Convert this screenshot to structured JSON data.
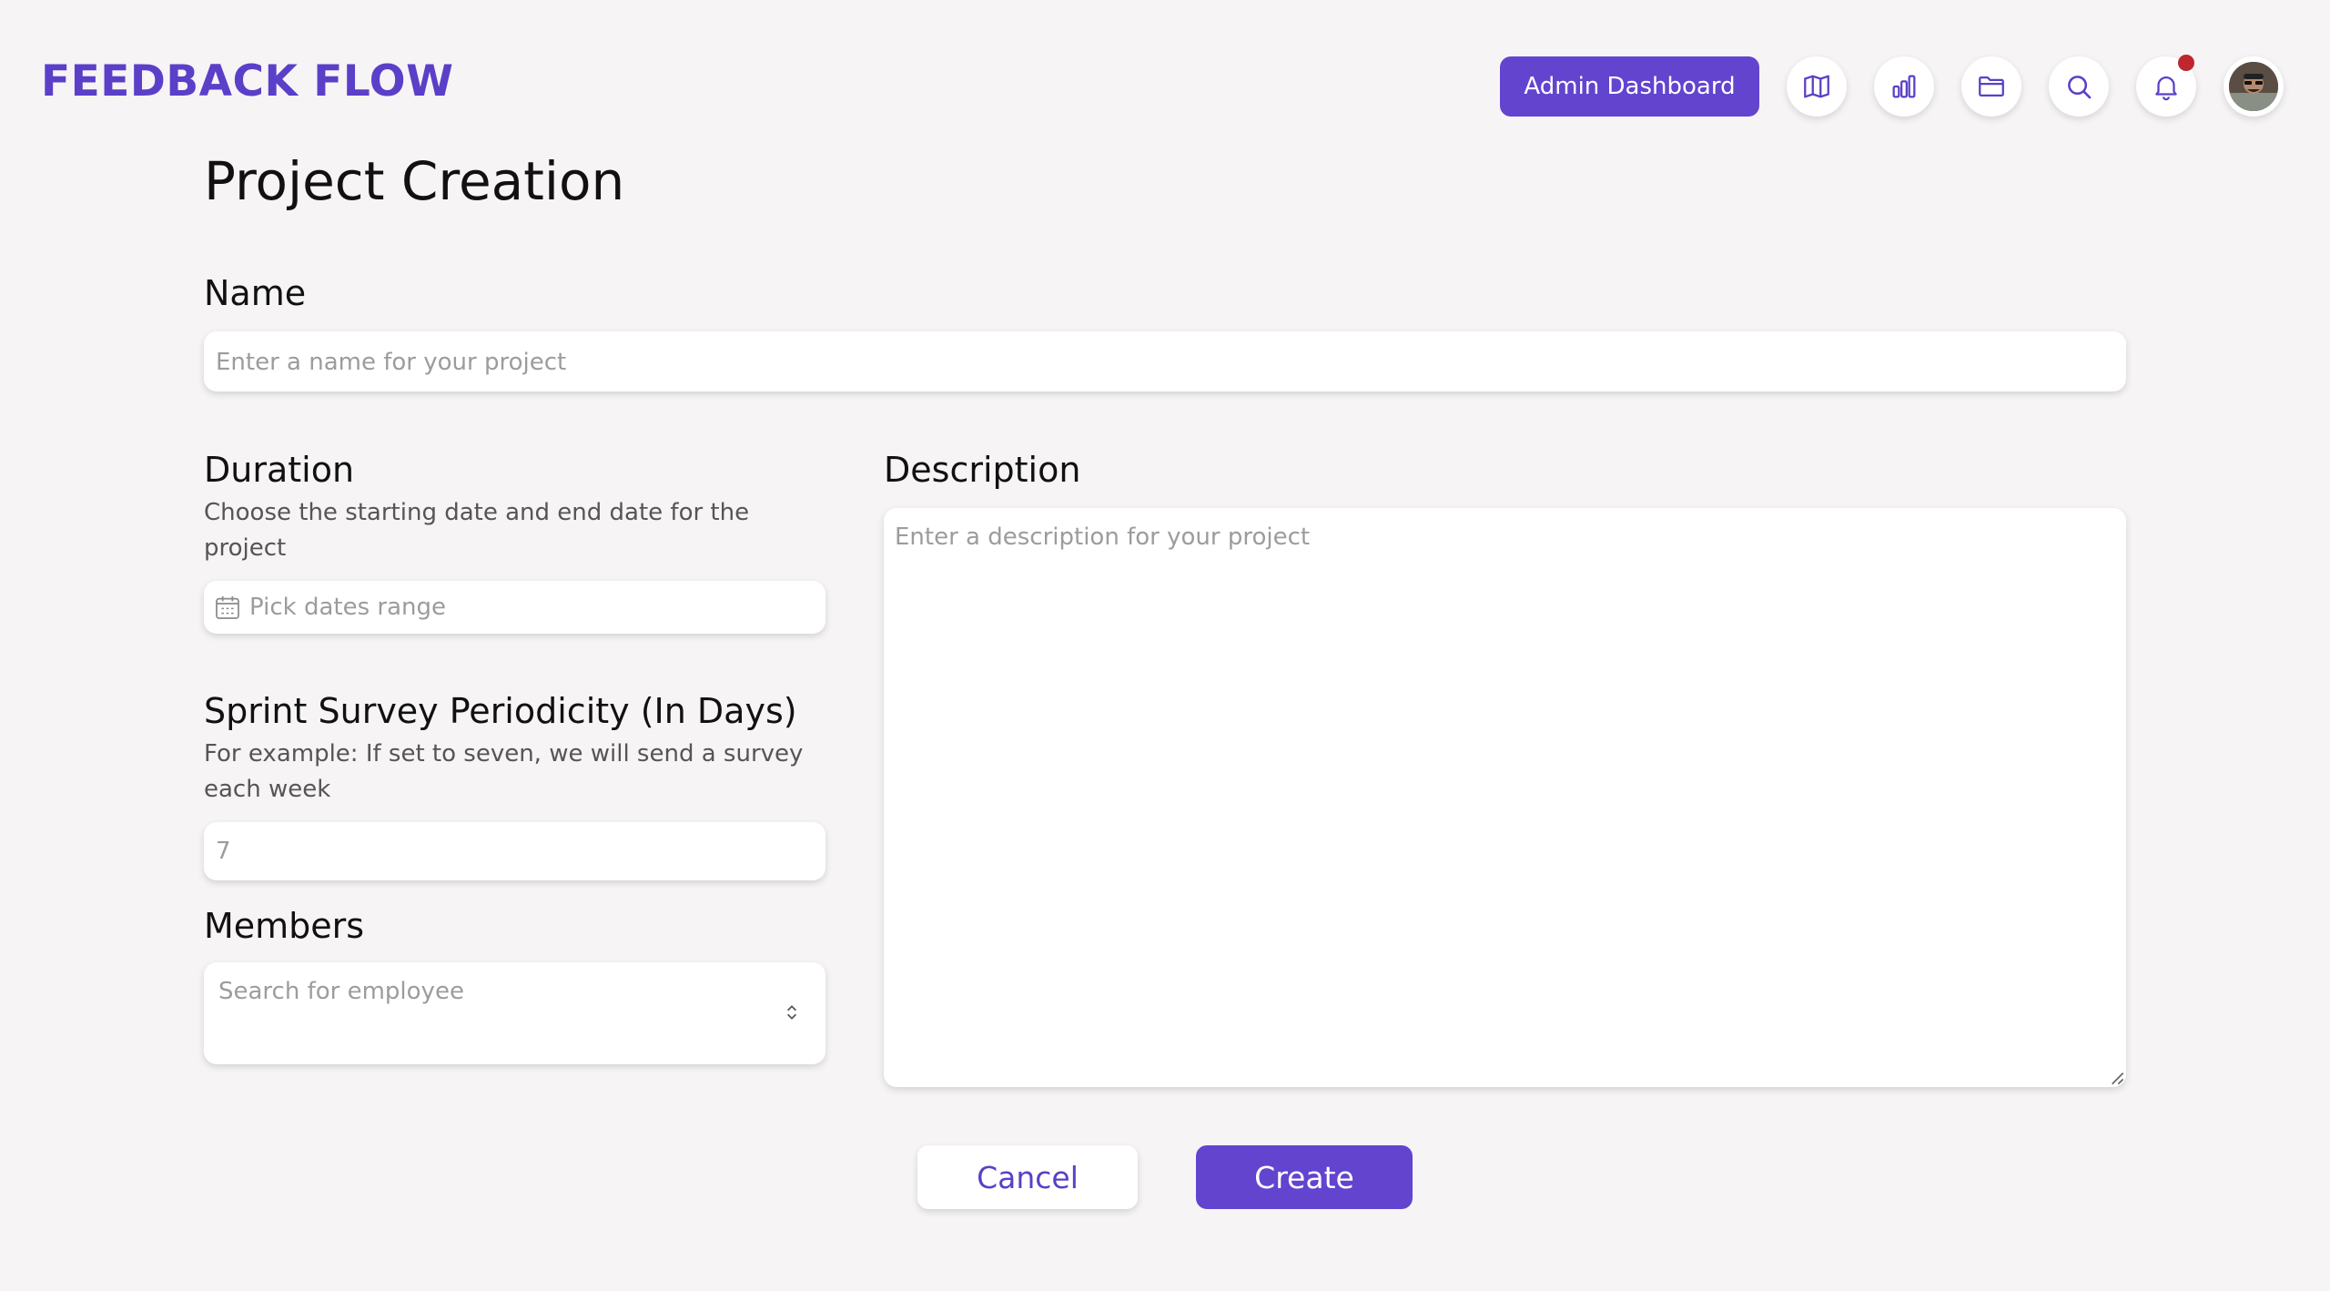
{
  "header": {
    "logo": "FEEDBACK FLOW",
    "admin_button": "Admin Dashboard",
    "icons": [
      "map-icon",
      "bar-chart-icon",
      "folder-icon",
      "search-icon",
      "bell-icon"
    ],
    "has_notification": true
  },
  "form": {
    "title": "Project Creation",
    "name": {
      "label": "Name",
      "placeholder": "Enter a name for your project"
    },
    "duration": {
      "label": "Duration",
      "hint": "Choose the starting date and end date for the project",
      "placeholder": "Pick dates range"
    },
    "description": {
      "label": "Description",
      "placeholder": "Enter a description for your project"
    },
    "periodicity": {
      "label": "Sprint Survey Periodicity (In Days)",
      "hint": "For example: If set to seven, we will send a survey each week",
      "placeholder": "7"
    },
    "members": {
      "label": "Members",
      "placeholder": "Search for employee"
    },
    "cancel_label": "Cancel",
    "create_label": "Create"
  },
  "colors": {
    "brand": "#5b3fc8",
    "primary_button": "#6244cf",
    "notification": "#c0262d",
    "background": "#f6f4f5"
  }
}
